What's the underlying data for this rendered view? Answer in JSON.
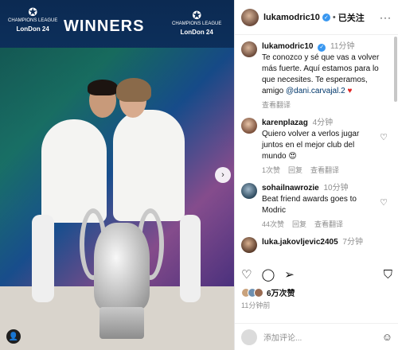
{
  "photo": {
    "banner": "WINNERS",
    "logo_text": "CHAMPIONS LEAGUE",
    "logo_city": "LonDon 24",
    "next_arrow": "›",
    "tag_icon": "person-tag-icon"
  },
  "header": {
    "username": "lukamodric10",
    "separator": "•",
    "follow_label": "已关注",
    "more": "···"
  },
  "comments": [
    {
      "username": "lukamodric10",
      "time": "11分钟",
      "text": "Te conozco y sé que vas a volver más fuerte. Aquí estamos para lo que necesites. Te esperamos, amigo",
      "mention": "@dani.carvajal.2",
      "emoji": "♥",
      "meta": [
        "查看翻译"
      ]
    },
    {
      "username": "karenplazag",
      "time": "4分钟",
      "text": "Quiero volver a verlos jugar juntos en el mejor club del mundo",
      "emoji": "😍",
      "meta": [
        "1次赞",
        "回复",
        "查看翻译"
      ]
    },
    {
      "username": "sohailnawrozie",
      "time": "10分钟",
      "text": "Beat friend awards goes to Modric",
      "meta": [
        "44次赞",
        "回复",
        "查看翻译"
      ]
    },
    {
      "username": "luka.jakovljevic2405",
      "time": "7分钟"
    }
  ],
  "actions": {
    "like_icon": "heart-icon",
    "comment_icon": "comment-icon",
    "share_icon": "send-icon",
    "save_icon": "bookmark-icon"
  },
  "likes": {
    "count": "6万次赞"
  },
  "posted_ago": "11分钟前",
  "compose": {
    "placeholder": "添加评论..."
  }
}
